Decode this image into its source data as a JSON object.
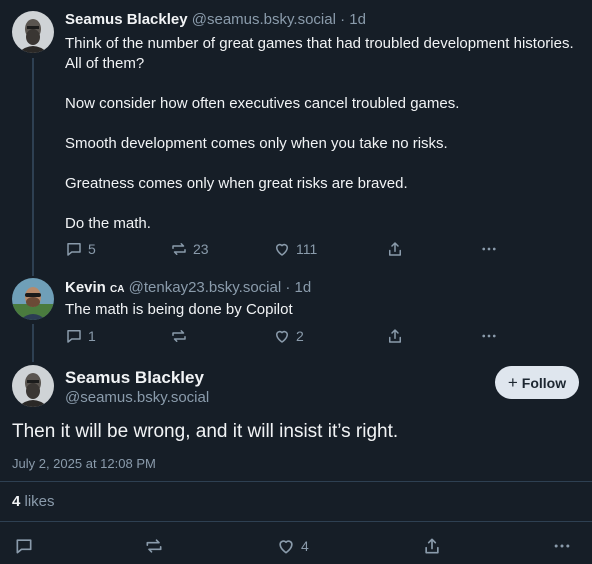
{
  "posts": [
    {
      "author": "Seamus Blackley",
      "handle": "@seamus.bsky.social",
      "time": "1d",
      "paragraphs": [
        "Think of the number of great games that had troubled development histories. All of them?",
        "Now consider how often executives cancel troubled games.",
        "Smooth development comes only when you take no risks.",
        "Greatness comes only when great risks are braved.",
        "Do the math."
      ],
      "stats": {
        "replies": "5",
        "reposts": "23",
        "likes": "111"
      }
    },
    {
      "author": "Kevin",
      "badge": "CA",
      "handle": "@tenkay23.bsky.social",
      "time": "1d",
      "paragraphs": [
        "The math is being done by Copilot"
      ],
      "stats": {
        "replies": "1",
        "reposts": "",
        "likes": "2"
      }
    }
  ],
  "main_post": {
    "author": "Seamus Blackley",
    "handle": "@seamus.bsky.social",
    "follow_label": "Follow",
    "text": "Then it will be wrong, and it will insist it’s right.",
    "timestamp": "July 2, 2025 at 12:08 PM",
    "like_count": "4",
    "like_word": "likes",
    "stats": {
      "likes": "4"
    }
  },
  "separator": " · ",
  "colors": {
    "background": "#161e27",
    "muted": "#8a9bab",
    "text": "#f1f3f5",
    "follow_bg": "#dfe6ee"
  }
}
